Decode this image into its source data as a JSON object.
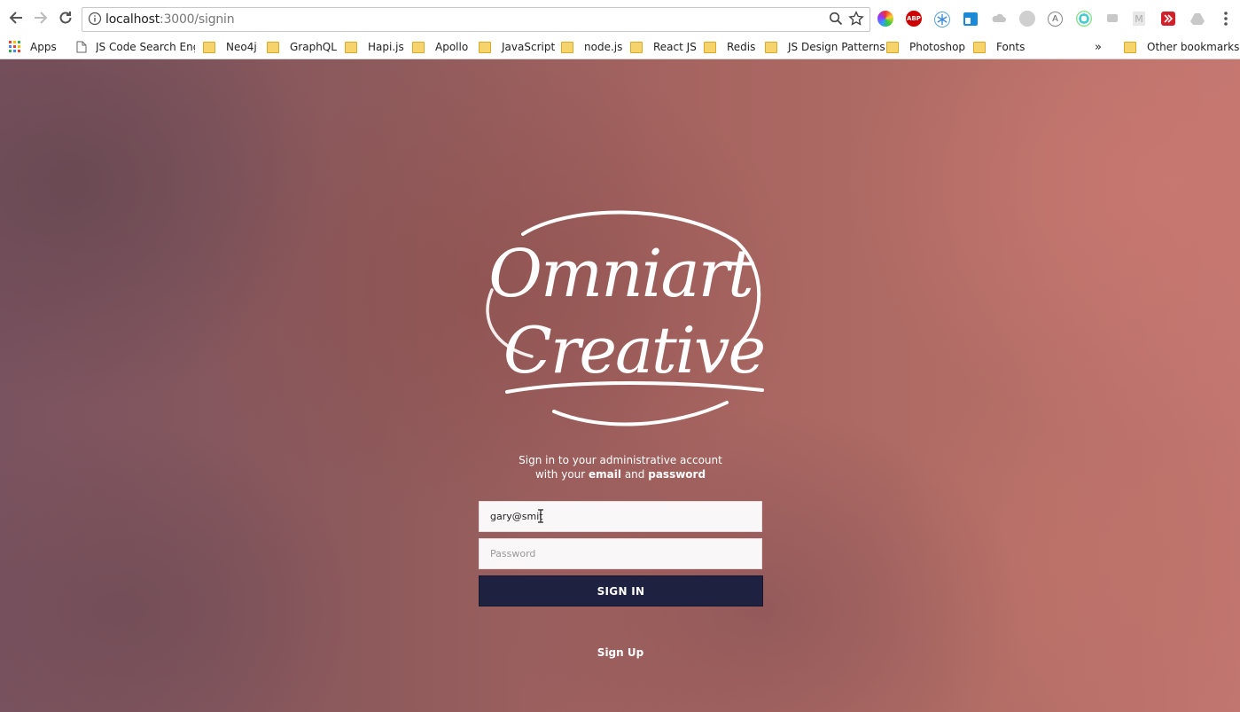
{
  "browser": {
    "url_host": "localhost",
    "url_path": ":3000/signin",
    "bookmarks": [
      {
        "label": "Apps",
        "type": "apps"
      },
      {
        "label": "JS Code Search Engi",
        "type": "page"
      },
      {
        "label": "Neo4j",
        "type": "folder"
      },
      {
        "label": "GraphQL",
        "type": "folder"
      },
      {
        "label": "Hapi.js",
        "type": "folder"
      },
      {
        "label": "Apollo",
        "type": "folder"
      },
      {
        "label": "JavaScript",
        "type": "folder"
      },
      {
        "label": "node.js",
        "type": "folder"
      },
      {
        "label": "React JS",
        "type": "folder"
      },
      {
        "label": "Redis",
        "type": "folder"
      },
      {
        "label": "JS Design Patterns",
        "type": "folder"
      },
      {
        "label": "Photoshop",
        "type": "folder"
      },
      {
        "label": "Fonts",
        "type": "folder"
      }
    ],
    "overflow_label": "»",
    "other_bookmarks": "Other bookmarks",
    "extensions": [
      "color-wheel-icon",
      "adblock-icon",
      "snowflake-icon",
      "window-icon",
      "cloud-icon",
      "circle-icon",
      "a-icon",
      "target-icon",
      "chat-icon",
      "m-icon",
      "forward-icon",
      "drive-icon"
    ],
    "abp_label": "ABP"
  },
  "logo": {
    "line1": "Omniart",
    "line2": "Creative"
  },
  "signin": {
    "tagline_pre": "Sign in to your administrative account",
    "tagline_with": "with your",
    "tagline_email": "email",
    "tagline_and": "and",
    "tagline_password": "password",
    "email_value": "gary@smit",
    "password_placeholder": "Password",
    "button_label": "SIGN IN",
    "signup_label": "Sign Up"
  }
}
